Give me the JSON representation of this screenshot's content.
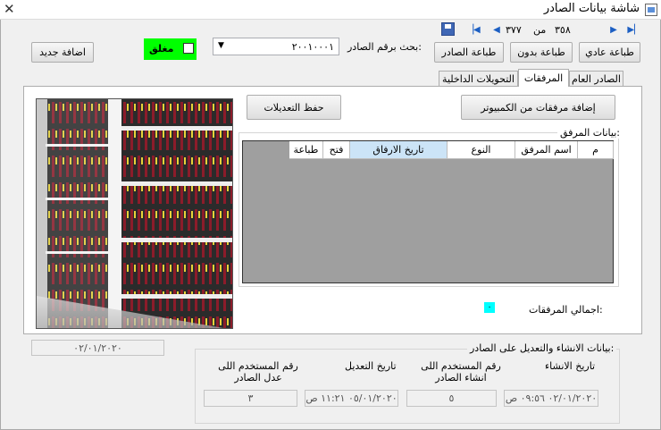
{
  "window": {
    "title": "شاشة بيانات الصادر"
  },
  "nav": {
    "current": "٣٥٨",
    "of_label": "من",
    "total": "٣٧٧"
  },
  "toolbar": {
    "print_normal": "طباعة عادي",
    "print_without": "طباعة بدون",
    "print_outgoing": "طباعة الصادر",
    "add_new": "اضافة جديد"
  },
  "search": {
    "label": "بحث برقم الصادر:",
    "value": "٢٠٠١٠٠٠١"
  },
  "closed_checkbox": {
    "label": "مغلق",
    "checked": false,
    "highlight_color": "#00ff00"
  },
  "tabs": [
    {
      "label": "الصادر العام",
      "active": false
    },
    {
      "label": "المرفقات",
      "active": true
    },
    {
      "label": "التحويلات الداخلية",
      "active": false
    }
  ],
  "attachments": {
    "add_from_pc": "إضافة مرفقات من الكمبيوتر",
    "save_changes": "حفظ التعديلات",
    "group_title": "بيانات المرفق:",
    "columns": [
      "م",
      "اسم المرفق",
      "النوع",
      "تاريخ الارفاق",
      "فتح",
      "طباعة"
    ],
    "total_label": "اجمالي المرفقات:",
    "total_value": "٠",
    "total_color": "#00ffff",
    "image_alt": "archive-shelves"
  },
  "date_box": "٠٢/٠١/٢٠٢٠",
  "audit": {
    "title": "بيانات الانشاء والتعديل على الصادر:",
    "created_date_label": "تاريخ الانشاء",
    "created_user_label": "رقم المستخدم اللى انشاء الصادر",
    "modified_date_label": "تاريخ التعديل",
    "modified_user_label": "رقم المستخدم اللى عدل الصادر",
    "created_date": "٠٢/٠١/٢٠٢٠ ٠٩:٥٦ ص",
    "created_user": "٥",
    "modified_date": "٠٥/٠١/٢٠٢٠ ١١:٢١ ص",
    "modified_user": "٣"
  }
}
